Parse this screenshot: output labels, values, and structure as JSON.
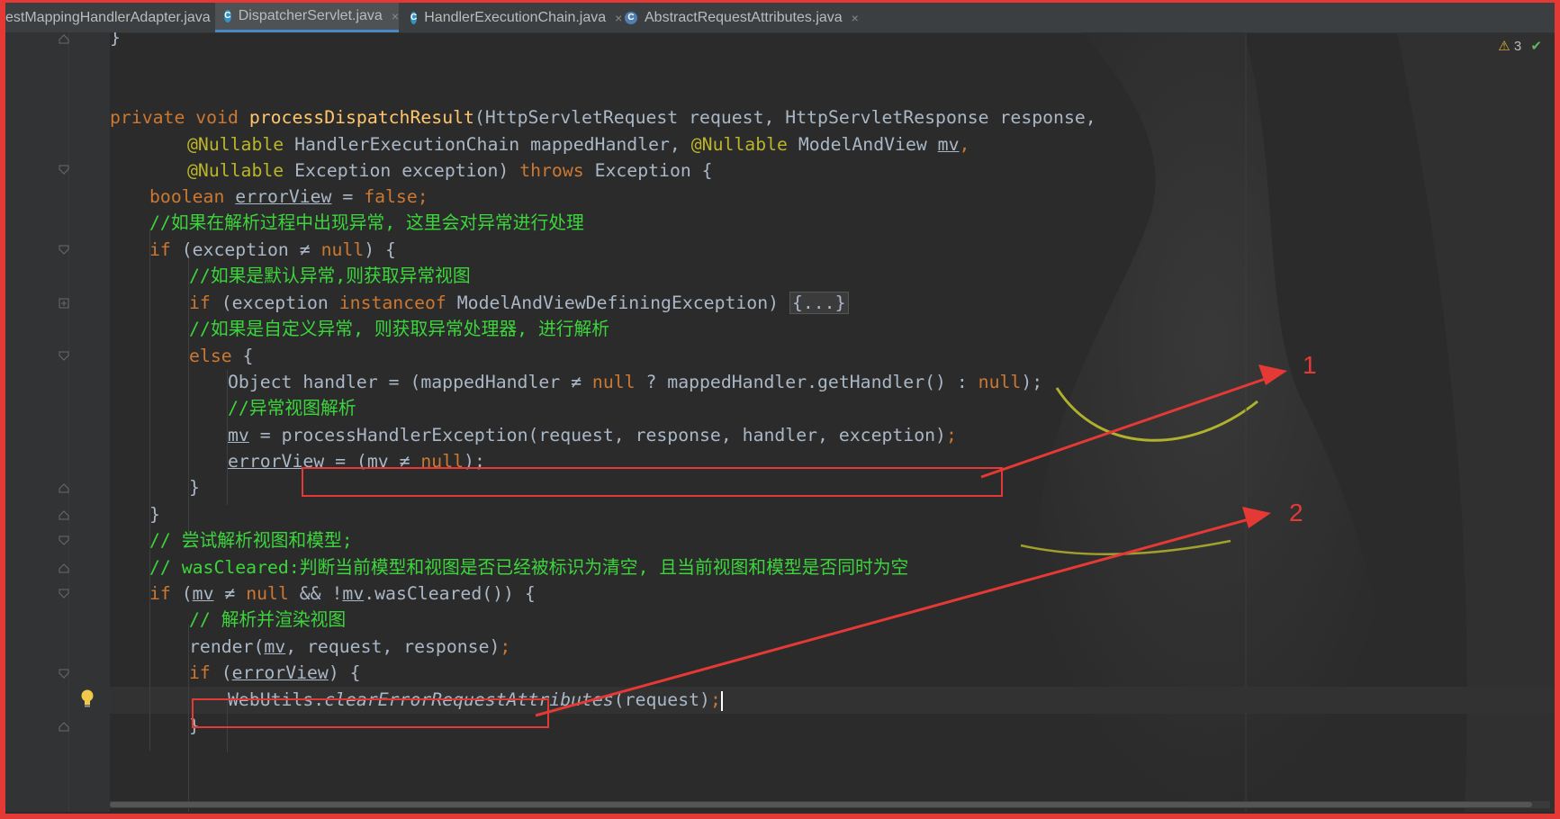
{
  "tabs": [
    {
      "label": "estMappingHandlerAdapter.java",
      "active": false
    },
    {
      "label": "DispatcherServlet.java",
      "active": true
    },
    {
      "label": "HandlerExecutionChain.java",
      "active": false
    },
    {
      "label": "AbstractRequestAttributes.java",
      "active": false
    }
  ],
  "tab_icon_glyph": "C",
  "tab_close_glyph": "×",
  "inspections": {
    "warning_count": "3",
    "warning_icon": "warning-triangle-icon",
    "ok_icon": "check-icon"
  },
  "code": {
    "l0": "}",
    "l3_kw": "private void ",
    "l3_fn": "processDispatchResult",
    "l3_rest": "(HttpServletRequest request, HttpServletResponse response,",
    "l4_ann1": "@Nullable",
    "l4_mid": " HandlerExecutionChain mappedHandler, ",
    "l4_ann2": "@Nullable",
    "l4_mid2": " ModelAndView ",
    "l4_var": "mv",
    "l4_end": ",",
    "l5_ann": "@Nullable",
    "l5_mid": " Exception exception) ",
    "l5_kw": "throws",
    "l5_end": " Exception {",
    "l6_kw": "boolean ",
    "l6_var": "errorView",
    "l6_mid": " = ",
    "l6_kw2": "false",
    "l6_end": ";",
    "l7_cm": "//如果在解析过程中出现异常, 这里会对异常进行处理",
    "l8_kw": "if",
    "l8_mid": " (exception ≠ ",
    "l8_kw2": "null",
    "l8_end": ") {",
    "l9_cm": "//如果是默认异常,则获取异常视图",
    "l10_kw": "if",
    "l10_mid": " (exception ",
    "l10_kw2": "instanceof",
    "l10_end": " ModelAndViewDefiningException) ",
    "l10_fold": "{...}",
    "l11_cm": "//如果是自定义异常, 则获取异常处理器, 进行解析",
    "l12_kw": "else",
    "l12_end": " {",
    "l13_a": "Object handler = (mappedHandler ≠ ",
    "l13_kw": "null",
    "l13_b": " ? mappedHandler.getHandler() : ",
    "l13_kw2": "null",
    "l13_end": ");",
    "l14_cm": "//异常视图解析",
    "l15_var": "mv",
    "l15_mid": " = ",
    "l15_call": "processHandlerException(request, response, handler, exception)",
    "l15_end": ";",
    "l16_var": "errorView",
    "l16_mid": " = (",
    "l16_var2": "mv",
    "l16_mid2": " ≠ ",
    "l16_kw": "null",
    "l16_end": ");",
    "l17": "}",
    "l18": "}",
    "l19_cm": "// 尝试解析视图和模型;",
    "l20_cm": "// wasCleared:判断当前模型和视图是否已经被标识为清空, 且当前视图和模型是否同时为空",
    "l21_kw": "if",
    "l21_a": " (",
    "l21_var": "mv",
    "l21_b": " ≠ ",
    "l21_kw2": "null",
    "l21_c": " && !",
    "l21_var2": "mv",
    "l21_end": ".wasCleared()) {",
    "l22_cm": "// 解析并渲染视图",
    "l23_a": "render(",
    "l23_var": "mv",
    "l23_b": ", request, response)",
    "l23_end": ";",
    "l24_kw": "if",
    "l24_a": " (",
    "l24_var": "errorView",
    "l24_end": ") {",
    "l25_a": "WebUtils.",
    "l25_it": "clearErrorRequestAttributes",
    "l25_b": "(request)",
    "l25_end": ";",
    "l26": "}"
  },
  "annotations": {
    "label1": "1",
    "label2": "2",
    "color": "#e53935"
  },
  "gutter_icons": {
    "bulb": "lightbulb-icon"
  },
  "colors": {
    "background": "#2b2b2b",
    "keyword": "#cc7832",
    "function": "#ffc66d",
    "annotation": "#bbb529",
    "comment": "#3cd63c",
    "text": "#a9b7c6"
  }
}
